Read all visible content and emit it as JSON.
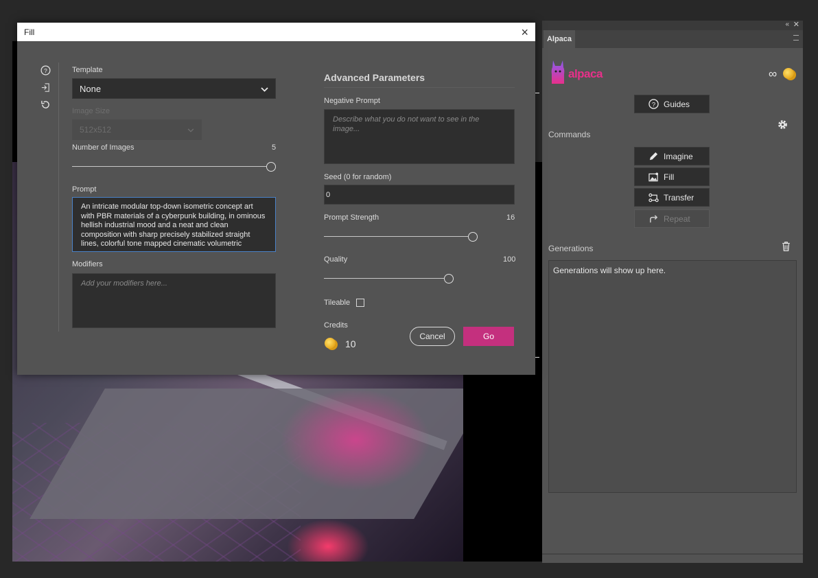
{
  "dialog": {
    "title": "Fill",
    "close": "×",
    "template": {
      "label": "Template",
      "value": "None"
    },
    "image_size": {
      "label": "Image Size",
      "value": "512x512"
    },
    "number_of_images": {
      "label": "Number of Images",
      "value": "5",
      "level": 1.0
    },
    "prompt": {
      "label": "Prompt",
      "value": "An intricate modular top-down isometric concept art with PBR materials of a cyberpunk building, in ominous hellish industrial mood and a neat and clean composition with sharp precisely stabilized straight lines, colorful tone mapped cinematic volumetric"
    },
    "modifiers": {
      "label": "Modifiers",
      "placeholder": "Add your modifiers here..."
    },
    "advanced": {
      "title": "Advanced Parameters",
      "negative_prompt": {
        "label": "Negative Prompt",
        "placeholder": "Describe what you do not want to see in the image..."
      },
      "seed": {
        "label": "Seed (0 for random)",
        "value": "0"
      },
      "prompt_strength": {
        "label": "Prompt Strength",
        "value": "16",
        "level": 0.8
      },
      "quality": {
        "label": "Quality",
        "value": "100",
        "level": 0.66
      },
      "tileable": {
        "label": "Tileable",
        "checked": false
      },
      "credits": {
        "label": "Credits",
        "value": "10"
      }
    },
    "buttons": {
      "cancel": "Cancel",
      "go": "Go"
    }
  },
  "panel": {
    "tab": "Alpaca",
    "logo_text": "alpaca",
    "infinity": "∞",
    "guides": "Guides",
    "commands_label": "Commands",
    "commands": [
      "Imagine",
      "Fill",
      "Transfer",
      "Repeat"
    ],
    "generations_label": "Generations",
    "generations_empty": "Generations will show up here."
  },
  "colors": {
    "accent": "#c4307e",
    "focus": "#4a82c8",
    "panel": "#535353"
  }
}
